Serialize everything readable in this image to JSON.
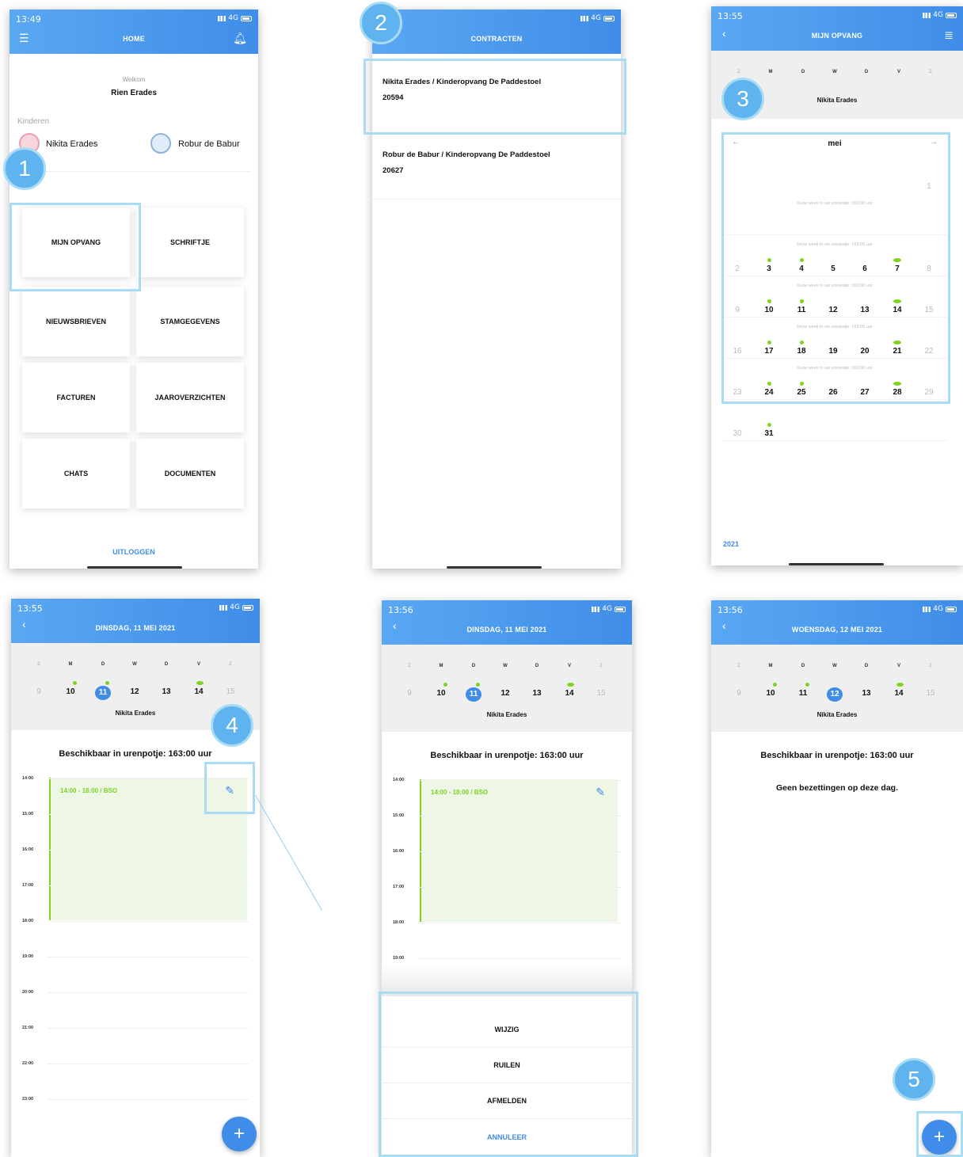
{
  "screen1": {
    "status": {
      "time": "13:49",
      "net": "4G"
    },
    "title": "HOME",
    "welcome": "Welkom",
    "user": "Rien Erades",
    "kids_label": "Kinderen",
    "kids": [
      "Nikita Erades",
      "Robur de Babur"
    ],
    "tiles": [
      "MIJN OPVANG",
      "SCHRIFTJE",
      "NIEUWSBRIEVEN",
      "STAMGEGEVENS",
      "FACTUREN",
      "JAAROVERZICHTEN",
      "CHATS",
      "DOCUMENTEN"
    ],
    "logout": "UITLOGGEN"
  },
  "screen2": {
    "status": {
      "net": "4G"
    },
    "title": "CONTRACTEN",
    "contracts": [
      {
        "name": "Nikita Erades / Kinderopvang De Paddestoel",
        "number": "20594"
      },
      {
        "name": "Robur de Babur / Kinderopvang De Paddestoel",
        "number": "20627"
      }
    ]
  },
  "screen3": {
    "status": {
      "time": "13:55",
      "net": "4G"
    },
    "title": "MIJN OPVANG",
    "weekdays": [
      "Z",
      "M",
      "D",
      "W",
      "D",
      "V",
      "Z"
    ],
    "child": "Nikita Erades",
    "month": "mei",
    "year": "2021",
    "week_note": "Deze week in uw urenpotje: 163:00 uur",
    "weeks": [
      [
        "",
        "",
        "",
        "",
        "",
        "",
        "1"
      ],
      [
        "2",
        "3",
        "4",
        "5",
        "6",
        "7",
        "8"
      ],
      [
        "9",
        "10",
        "11",
        "12",
        "13",
        "14",
        "15"
      ],
      [
        "16",
        "17",
        "18",
        "19",
        "20",
        "21",
        "22"
      ],
      [
        "23",
        "24",
        "25",
        "26",
        "27",
        "28",
        "29"
      ],
      [
        "30",
        "31",
        "",
        "",
        "",
        "",
        ""
      ]
    ]
  },
  "screen4": {
    "status": {
      "time": "13:55",
      "net": "4G"
    },
    "title": "DINSDAG, 11 MEI 2021",
    "child": "Nikita Erades",
    "available": "Beschikbaar in urenpotje: 163:00 uur",
    "booking": "14:00 - 18:00 / BSO",
    "hours": [
      "14:00",
      "15:00",
      "16:00",
      "17:00",
      "18:00",
      "19:00",
      "20:00",
      "21:00",
      "22:00",
      "23:00"
    ]
  },
  "screen5": {
    "status": {
      "time": "13:56",
      "net": "4G"
    },
    "title": "DINSDAG, 11 MEI 2021",
    "child": "Nikita Erades",
    "available": "Beschikbaar in urenpotje: 163:00 uur",
    "booking": "14:00 - 18:00 / BSO",
    "hours": [
      "14:00",
      "15:00",
      "16:00",
      "17:00",
      "18:00",
      "19:00"
    ],
    "actions": [
      "WIJZIG",
      "RUILEN",
      "AFMELDEN"
    ],
    "cancel": "ANNULEER"
  },
  "screen6": {
    "status": {
      "time": "13:56",
      "net": "4G"
    },
    "title": "WOENSDAG, 12 MEI 2021",
    "child": "Nikita Erades",
    "available": "Beschikbaar in urenpotje: 163:00 uur",
    "empty": "Geen bezettingen op deze dag."
  },
  "week_strip": {
    "days": [
      "Z",
      "M",
      "D",
      "W",
      "D",
      "V",
      "Z"
    ],
    "dates": [
      "9",
      "10",
      "11",
      "12",
      "13",
      "14",
      "15"
    ]
  },
  "steps": [
    "1",
    "2",
    "3",
    "4",
    "5"
  ],
  "colors": {
    "header": "#3f8de8",
    "accent_green": "#7ed321",
    "callout": "#a8dcf4"
  }
}
